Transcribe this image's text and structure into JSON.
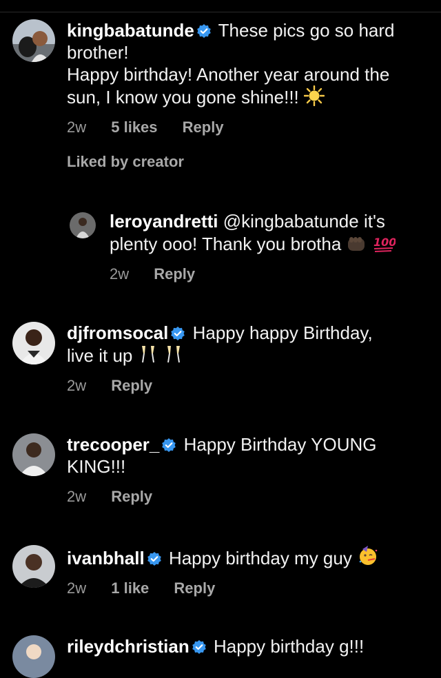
{
  "comments": [
    {
      "username": "kingbabatunde",
      "text_line1": "These pics go so hard",
      "text_line2": "brother!",
      "text_line3": "Happy birthday! Another year around the",
      "text_line4": "sun, I know you gone shine!!!",
      "emoji": "sun-icon",
      "time": "2w",
      "likes": "5 likes",
      "reply_label": "Reply",
      "liked_by": "Liked by creator"
    },
    {
      "username": "leroyandretti",
      "mention": "@kingbabatunde",
      "text_line1": "it's",
      "text_line2": "plenty ooo! Thank you brotha",
      "emoji": [
        "fist-icon",
        "hundred-icon"
      ],
      "time": "2w",
      "reply_label": "Reply"
    },
    {
      "username": "djfromsocal",
      "text_line1": "Happy happy Birthday,",
      "text_line2": "live it up",
      "emoji": [
        "champagne-glasses-icon",
        "champagne-glasses-icon"
      ],
      "time": "2w",
      "reply_label": "Reply"
    },
    {
      "username": "trecooper_",
      "text_line1": "Happy Birthday YOUNG",
      "text_line2": "KING!!!",
      "time": "2w",
      "reply_label": "Reply"
    },
    {
      "username": "ivanbhall",
      "text_line1": "Happy birthday my guy",
      "emoji": "partying-face-icon",
      "time": "2w",
      "likes": "1 like",
      "reply_label": "Reply"
    },
    {
      "username": "rileydchristian",
      "text_line1": "Happy birthday g!!!"
    }
  ],
  "colors": {
    "background": "#000000",
    "text": "#f2f2f2",
    "meta": "#9a9a9a",
    "verified": "#3897f0"
  }
}
